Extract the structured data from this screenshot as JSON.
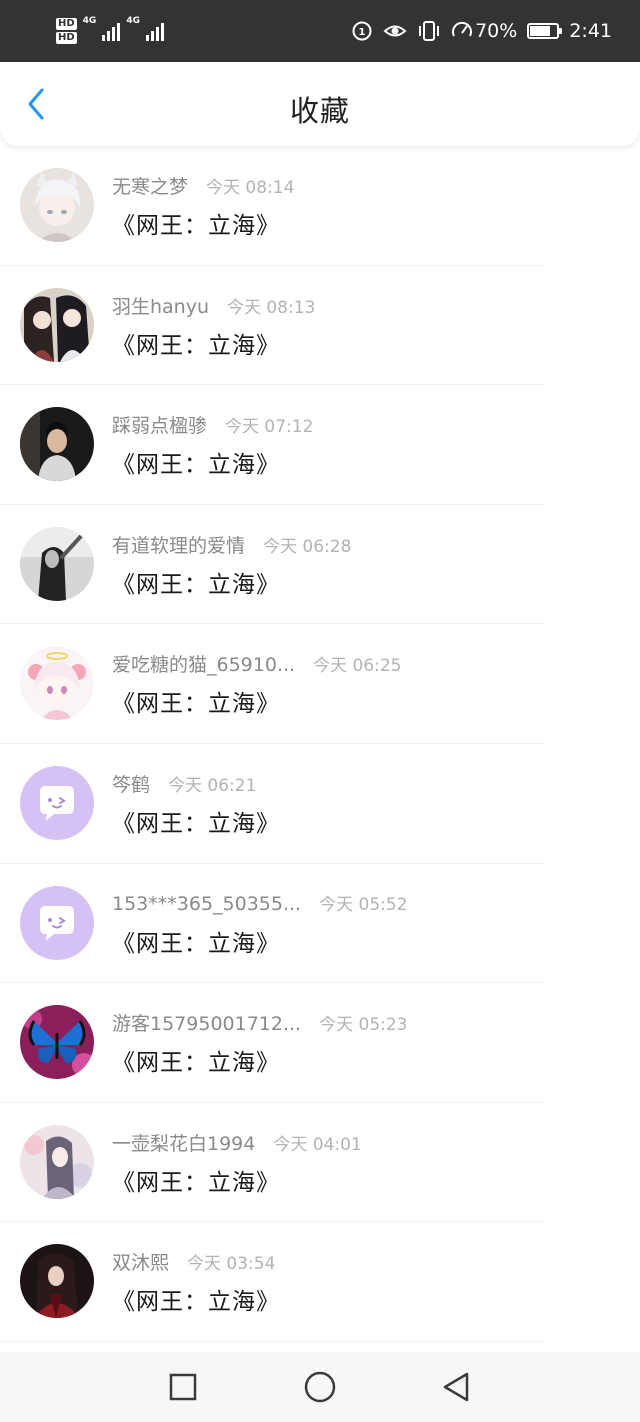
{
  "status_bar": {
    "hd1": "HD",
    "hd2": "HD",
    "net1": "4G",
    "net2": "4G",
    "battery_text": "70%",
    "battery_level": 0.7,
    "time": "2:41"
  },
  "header": {
    "title": "收藏",
    "back_icon": "chevron-left-icon",
    "accent": "#2196f3"
  },
  "items": [
    {
      "name": "无寒之梦",
      "time": "今天 08:14",
      "work": "《网王：立海》",
      "avatar": "anime-avatar"
    },
    {
      "name": "羽生hanyu",
      "time": "今天 08:13",
      "work": "《网王：立海》",
      "avatar": "anime-avatar"
    },
    {
      "name": "踩弱点楹骖",
      "time": "今天 07:12",
      "work": "《网王：立海》",
      "avatar": "photo-avatar"
    },
    {
      "name": "有道软理的爱情",
      "time": "今天 06:28",
      "work": "《网王：立海》",
      "avatar": "photo-avatar"
    },
    {
      "name": "爱吃糖的猫_65910...",
      "time": "今天 06:25",
      "work": "《网王：立海》",
      "avatar": "anime-avatar"
    },
    {
      "name": "笒鹤",
      "time": "今天 06:21",
      "work": "《网王：立海》",
      "avatar": "default-avatar"
    },
    {
      "name": "153***365_50355...",
      "time": "今天 05:52",
      "work": "《网王：立海》",
      "avatar": "default-avatar"
    },
    {
      "name": "游客15795001712...",
      "time": "今天 05:23",
      "work": "《网王：立海》",
      "avatar": "butterfly-avatar"
    },
    {
      "name": "一壶梨花白1994",
      "time": "今天 04:01",
      "work": "《网王：立海》",
      "avatar": "anime-avatar"
    },
    {
      "name": "双沐熙",
      "time": "今天 03:54",
      "work": "《网王：立海》",
      "avatar": "anime-avatar"
    }
  ],
  "nav_bar": {
    "recents_icon": "square-icon",
    "home_icon": "circle-icon",
    "back_icon": "triangle-back-icon"
  }
}
